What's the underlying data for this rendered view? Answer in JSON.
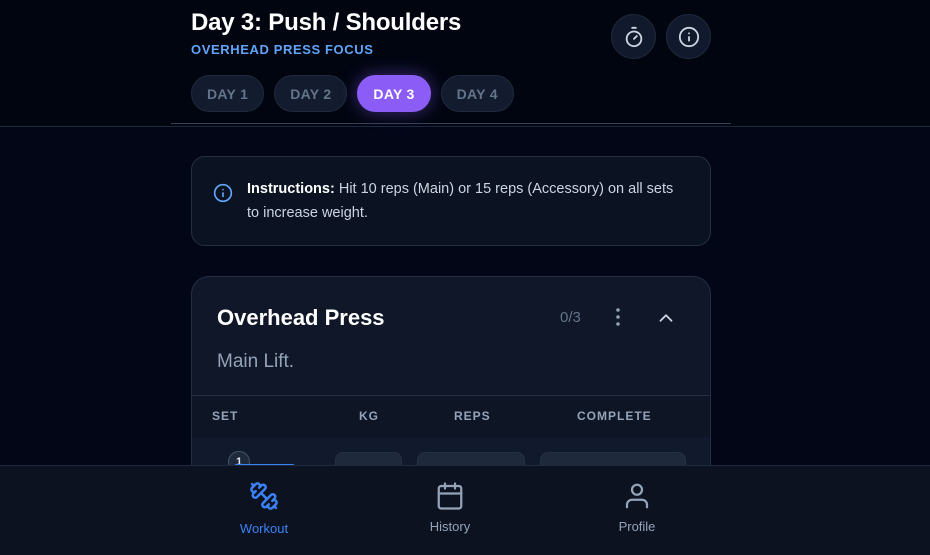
{
  "header": {
    "title": "Day 3: Push / Shoulders",
    "subtitle": "OVERHEAD PRESS FOCUS"
  },
  "tabs": [
    {
      "label": "DAY 1",
      "active": false
    },
    {
      "label": "DAY 2",
      "active": false
    },
    {
      "label": "DAY 3",
      "active": true
    },
    {
      "label": "DAY 4",
      "active": false
    }
  ],
  "icons": {
    "timer": "stopwatch-icon",
    "info": "info-icon"
  },
  "instructions": {
    "label": "Instructions:",
    "text": " Hit 10 reps (Main) or 15 reps (Accessory) on all sets to increase weight."
  },
  "exercise": {
    "name": "Overhead Press",
    "progress": "0/3",
    "description": "Main Lift.",
    "columns": [
      "SET",
      "KG",
      "REPS",
      "COMPLETE"
    ],
    "sets": [
      {
        "number": "1"
      }
    ]
  },
  "nav": [
    {
      "label": "Workout",
      "icon": "dumbbell-icon",
      "active": true
    },
    {
      "label": "History",
      "icon": "calendar-icon",
      "active": false
    },
    {
      "label": "Profile",
      "icon": "user-icon",
      "active": false
    }
  ],
  "colors": {
    "accent_purple": "#8b5cf6",
    "accent_blue": "#3b82f6",
    "subtitle_blue": "#60a5fa",
    "background": "#020617"
  }
}
